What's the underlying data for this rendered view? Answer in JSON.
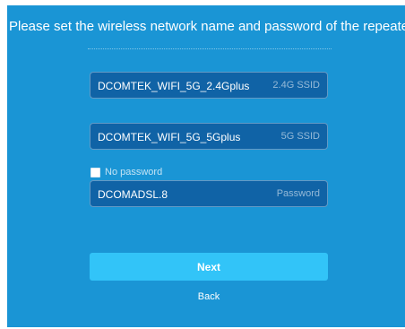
{
  "page": {
    "heading": "Please set the wireless network name and password of the repeater"
  },
  "form": {
    "ssid_24": {
      "value": "DCOMTEK_WIFI_5G_2.4Gplus",
      "tag": "2.4G SSID"
    },
    "ssid_5": {
      "value": "DCOMTEK_WIFI_5G_5Gplus",
      "tag": "5G SSID"
    },
    "no_password": {
      "label": "No password",
      "checked": false
    },
    "password": {
      "value": "DCOMADSL.8",
      "tag": "Password"
    }
  },
  "actions": {
    "next_label": "Next",
    "back_label": "Back"
  },
  "colors": {
    "panel": "#1a95d5",
    "field": "#1063a6",
    "button": "#32c4f8"
  }
}
